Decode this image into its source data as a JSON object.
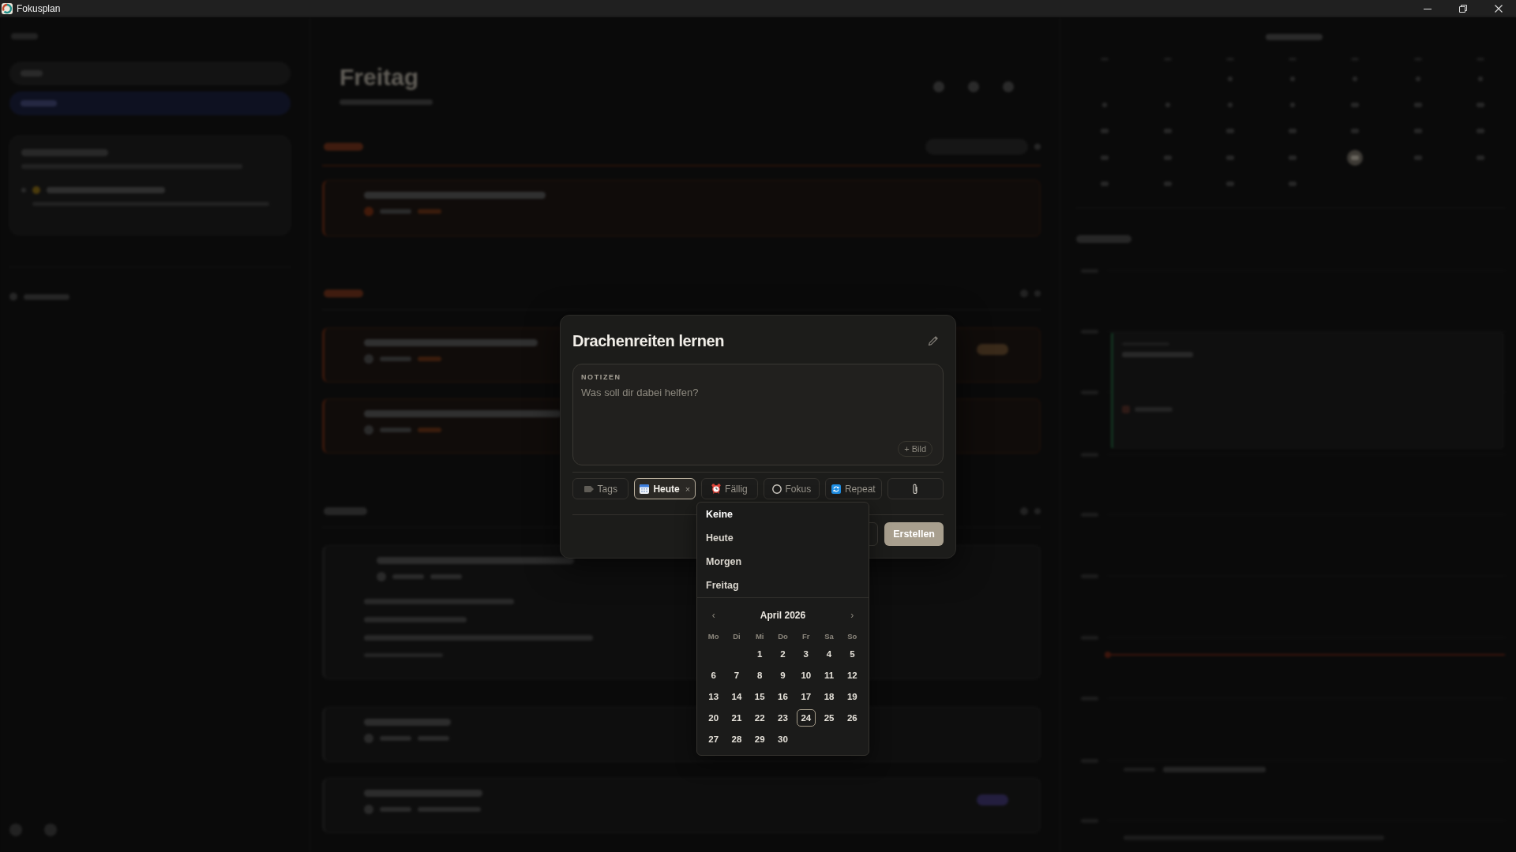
{
  "window": {
    "title": "Fokusplan"
  },
  "background": {
    "page_title": "Freitag"
  },
  "dialog": {
    "title": "Drachenreiten lernen",
    "notes": {
      "label": "NOTIZEN",
      "placeholder": "Was soll dir dabei helfen?",
      "add_image": "+ Bild"
    },
    "chips": [
      {
        "kind": "tags",
        "label": "Tags",
        "selected": false
      },
      {
        "kind": "date",
        "label": "Heute",
        "selected": true,
        "remove": "×"
      },
      {
        "kind": "due",
        "label": "Fällig",
        "selected": false
      },
      {
        "kind": "focus",
        "label": "Fokus",
        "selected": false
      },
      {
        "kind": "repeat",
        "label": "Repeat",
        "selected": false
      },
      {
        "kind": "attachment",
        "selected": false
      }
    ],
    "submit": "Erstellen"
  },
  "date_menu": {
    "options": [
      {
        "label": "Keine",
        "selected": true
      },
      {
        "label": "Heute",
        "selected": false
      },
      {
        "label": "Morgen",
        "selected": false
      },
      {
        "label": "Freitag",
        "selected": false
      }
    ],
    "calendar": {
      "prev": "‹",
      "month": "April 2026",
      "next": "›",
      "weekdays": [
        "Mo",
        "Di",
        "Mi",
        "Do",
        "Fr",
        "Sa",
        "So"
      ],
      "weeks": [
        [
          {
            "kind": "blank"
          },
          {
            "kind": "blank"
          },
          {
            "kind": "day",
            "label": "1",
            "selected": false
          },
          {
            "kind": "day",
            "label": "2",
            "selected": false
          },
          {
            "kind": "day",
            "label": "3",
            "selected": false
          },
          {
            "kind": "day",
            "label": "4",
            "selected": false
          },
          {
            "kind": "day",
            "label": "5",
            "selected": false
          }
        ],
        [
          {
            "kind": "day",
            "label": "6",
            "selected": false
          },
          {
            "kind": "day",
            "label": "7",
            "selected": false
          },
          {
            "kind": "day",
            "label": "8",
            "selected": false
          },
          {
            "kind": "day",
            "label": "9",
            "selected": false
          },
          {
            "kind": "day",
            "label": "10",
            "selected": false
          },
          {
            "kind": "day",
            "label": "11",
            "selected": false
          },
          {
            "kind": "day",
            "label": "12",
            "selected": false
          }
        ],
        [
          {
            "kind": "day",
            "label": "13",
            "selected": false
          },
          {
            "kind": "day",
            "label": "14",
            "selected": false
          },
          {
            "kind": "day",
            "label": "15",
            "selected": false
          },
          {
            "kind": "day",
            "label": "16",
            "selected": false
          },
          {
            "kind": "day",
            "label": "17",
            "selected": false
          },
          {
            "kind": "day",
            "label": "18",
            "selected": false
          },
          {
            "kind": "day",
            "label": "19",
            "selected": false
          }
        ],
        [
          {
            "kind": "day",
            "label": "20",
            "selected": false
          },
          {
            "kind": "day",
            "label": "21",
            "selected": false
          },
          {
            "kind": "day",
            "label": "22",
            "selected": false
          },
          {
            "kind": "day",
            "label": "23",
            "selected": false
          },
          {
            "kind": "day",
            "label": "24",
            "selected": true
          },
          {
            "kind": "day",
            "label": "25",
            "selected": false
          },
          {
            "kind": "day",
            "label": "26",
            "selected": false
          }
        ],
        [
          {
            "kind": "day",
            "label": "27",
            "selected": false
          },
          {
            "kind": "day",
            "label": "28",
            "selected": false
          },
          {
            "kind": "day",
            "label": "29",
            "selected": false
          },
          {
            "kind": "day",
            "label": "30",
            "selected": false
          }
        ]
      ]
    }
  }
}
